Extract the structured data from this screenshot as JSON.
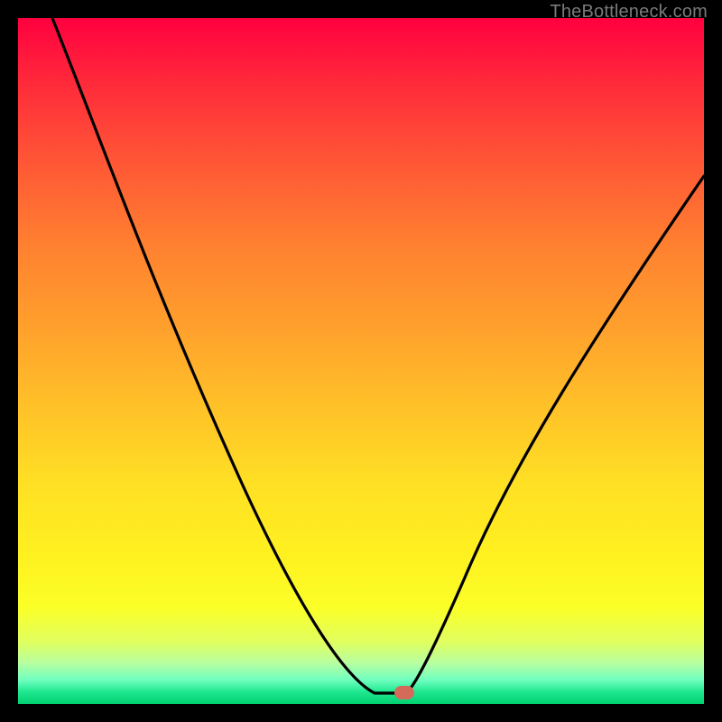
{
  "watermark": "TheBottleneck.com",
  "chart_data": {
    "type": "line",
    "title": "",
    "xlabel": "",
    "ylabel": "",
    "xlim": [
      0,
      100
    ],
    "ylim": [
      0,
      100
    ],
    "grid": false,
    "legend": false,
    "series": [
      {
        "name": "curve",
        "x": [
          5,
          12,
          20,
          28,
          35,
          42,
          48,
          52,
          54,
          56,
          58,
          60,
          65,
          72,
          80,
          88,
          95,
          100
        ],
        "y": [
          100,
          86,
          72,
          58,
          44,
          30,
          16,
          6,
          1,
          0,
          0,
          3,
          14,
          30,
          46,
          60,
          70,
          77
        ]
      }
    ],
    "marker": {
      "x": 56,
      "y": 0,
      "color": "#d46a5a"
    },
    "background_gradient": {
      "top": "#ff003f",
      "mid": "#ffe024",
      "bottom": "#00d070"
    }
  }
}
